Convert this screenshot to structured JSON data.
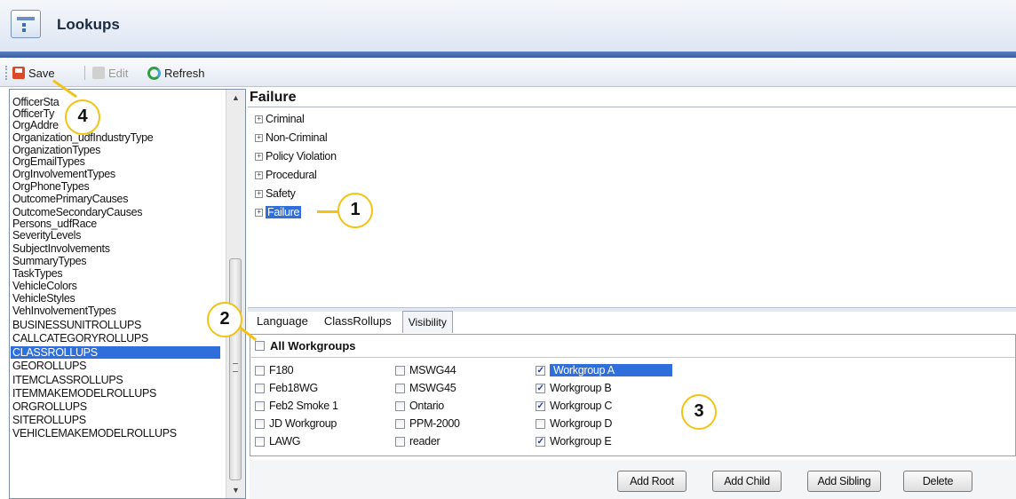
{
  "window": {
    "title": "Lookups"
  },
  "toolbar": {
    "save": "Save",
    "edit": "Edit",
    "refresh": "Refresh"
  },
  "lookup_list": {
    "items": [
      "OfficerSta",
      "OfficerTy",
      "OrgAddre",
      "Organization_udfIndustryType",
      "OrganizationTypes",
      "OrgEmailTypes",
      "OrgInvolvementTypes",
      "OrgPhoneTypes",
      "OutcomePrimaryCauses",
      "OutcomeSecondaryCauses",
      "Persons_udfRace",
      "SeverityLevels",
      "SubjectInvolvements",
      "SummaryTypes",
      "TaskTypes",
      "VehicleColors",
      "VehicleStyles",
      "VehInvolvementTypes",
      "BUSINESSUNITROLLUPS",
      "CALLCATEGORYROLLUPS",
      "CLASSROLLUPS",
      "GEOROLLUPS",
      "ITEMCLASSROLLUPS",
      "ITEMMAKEMODELROLLUPS",
      "ORGROLLUPS",
      "SITEROLLUPS",
      "VEHICLEMAKEMODELROLLUPS"
    ],
    "selected": "CLASSROLLUPS"
  },
  "detail": {
    "title": "Failure",
    "tree": [
      {
        "label": "Criminal",
        "expander": "+"
      },
      {
        "label": "Non-Criminal",
        "expander": "+"
      },
      {
        "label": "Policy Violation",
        "expander": "+"
      },
      {
        "label": "Procedural",
        "expander": "+"
      },
      {
        "label": "Safety",
        "expander": "+"
      },
      {
        "label": "Failure",
        "expander": "+",
        "selected": true
      }
    ],
    "tabs": [
      "Language",
      "ClassRollups",
      "Visibility"
    ],
    "active_tab": "Visibility",
    "all_workgroups_label": "All Workgroups",
    "workgroups": [
      {
        "label": "F180",
        "checked": false
      },
      {
        "label": "Feb18WG",
        "checked": false
      },
      {
        "label": "Feb2 Smoke 1",
        "checked": false
      },
      {
        "label": "JD Workgroup",
        "checked": false
      },
      {
        "label": "LAWG",
        "checked": false
      },
      {
        "label": "MSWG44",
        "checked": false
      },
      {
        "label": "MSWG45",
        "checked": false
      },
      {
        "label": "Ontario",
        "checked": false
      },
      {
        "label": "PPM-2000",
        "checked": false
      },
      {
        "label": "reader",
        "checked": false
      },
      {
        "label": "Workgroup A",
        "checked": true,
        "selected": true
      },
      {
        "label": "Workgroup B",
        "checked": true
      },
      {
        "label": "Workgroup C",
        "checked": true
      },
      {
        "label": "Workgroup D",
        "checked": false
      },
      {
        "label": "Workgroup E",
        "checked": true
      }
    ],
    "buttons": {
      "add_root": "Add Root",
      "add_child": "Add Child",
      "add_sibling": "Add Sibling",
      "delete": "Delete"
    }
  },
  "callouts": [
    "1",
    "2",
    "3",
    "4"
  ],
  "colors": {
    "selection": "#2f6fdc",
    "callout_ring": "#f3c314",
    "title_band": "#3c5f9d"
  }
}
